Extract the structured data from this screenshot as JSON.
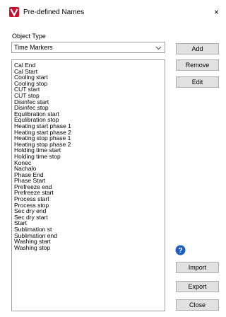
{
  "window": {
    "title": "Pre-defined Names",
    "close_glyph": "×",
    "app_icon": "v-logo-icon",
    "brand_color": "#c8102e"
  },
  "object_type": {
    "label": "Object Type",
    "selected": "Time Markers"
  },
  "names": [
    "Cal End",
    "Cal Start",
    "Cooling start",
    "Cooling stop",
    "CUT start",
    "CUT stop",
    "Disinfec start",
    "Disinfec stop",
    "Equlibration start",
    "Equlibration stop",
    "Heating start phase 1",
    "Heating start phase 2",
    "Heating stop phase 1",
    "Heating stop phase 2",
    "Holding  time start",
    "Holding time stop",
    "Konec",
    "Nachalo",
    "Phase End",
    "Phase Start",
    "Prefreeze end",
    "Prefreeze start",
    "Process start",
    "Process stop",
    "Sec dry end",
    "Sec dry start",
    "Start",
    "Sublimation  st",
    "Sublimation end",
    "Washing start",
    "Washing stop"
  ],
  "buttons": {
    "add": "Add",
    "remove": "Remove",
    "edit": "Edit",
    "import": "Import",
    "export": "Export",
    "close": "Close"
  },
  "help_icon": "help-circle-icon",
  "help_color": "#1f5fbf"
}
